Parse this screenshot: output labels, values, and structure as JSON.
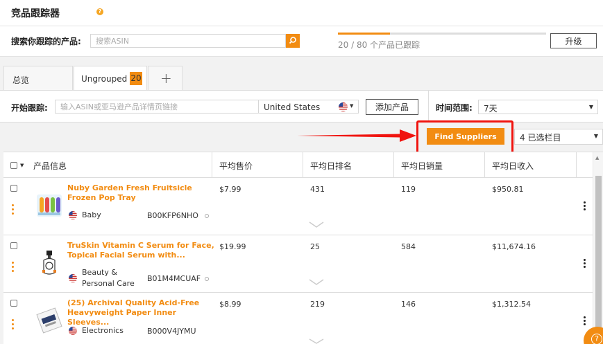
{
  "header": {
    "title": "竞品跟踪器",
    "help_icon": "?"
  },
  "search": {
    "label": "搜索你跟踪的产品:",
    "placeholder": "搜索ASIN",
    "icon": "search-icon"
  },
  "quota": {
    "text": "20 / 80 个产品已跟踪",
    "progress_fraction": 0.25
  },
  "upgrade_label": "升级",
  "tabs": [
    {
      "label": "总览"
    },
    {
      "label": "Ungrouped",
      "badge": "20"
    },
    {
      "label": "+"
    }
  ],
  "track": {
    "label": "开始跟踪:",
    "placeholder": "输入ASIN或亚马逊产品详情页链接",
    "country": "United States",
    "add_label": "添加产品",
    "range_label": "时间范围:",
    "range_value": "7天"
  },
  "actions": {
    "find_suppliers": "Find Suppliers",
    "columns_selected": "4 已选栏目"
  },
  "table": {
    "headers": [
      "产品信息",
      "平均售价",
      "平均日排名",
      "平均日销量",
      "平均日收入"
    ],
    "rows": [
      {
        "title_line1": "Nuby Garden Fresh Fruitsicle",
        "title_line2": "Frozen Pop Tray",
        "category": "Baby",
        "asin": "B00KFP6NHO",
        "price": "$7.99",
        "rank": "431",
        "sales": "119",
        "revenue": "$950.81"
      },
      {
        "title_line1": "TruSkin Vitamin C Serum for Face,",
        "title_line2": "Topical Facial Serum with...",
        "category_line1": "Beauty &",
        "category_line2": "Personal Care",
        "asin": "B01M4MCUAF",
        "price": "$19.99",
        "rank": "25",
        "sales": "584",
        "revenue": "$11,674.16"
      },
      {
        "title_line1": "(25) Archival Quality Acid-Free",
        "title_line2": "Heavyweight Paper Inner Sleeves...",
        "category": "Electronics",
        "asin": "B000V4JYMU",
        "price": "$8.99",
        "rank": "219",
        "sales": "146",
        "revenue": "$1,312.54"
      }
    ]
  },
  "colors": {
    "accent": "#f28c12",
    "highlight": "#f0140f"
  }
}
